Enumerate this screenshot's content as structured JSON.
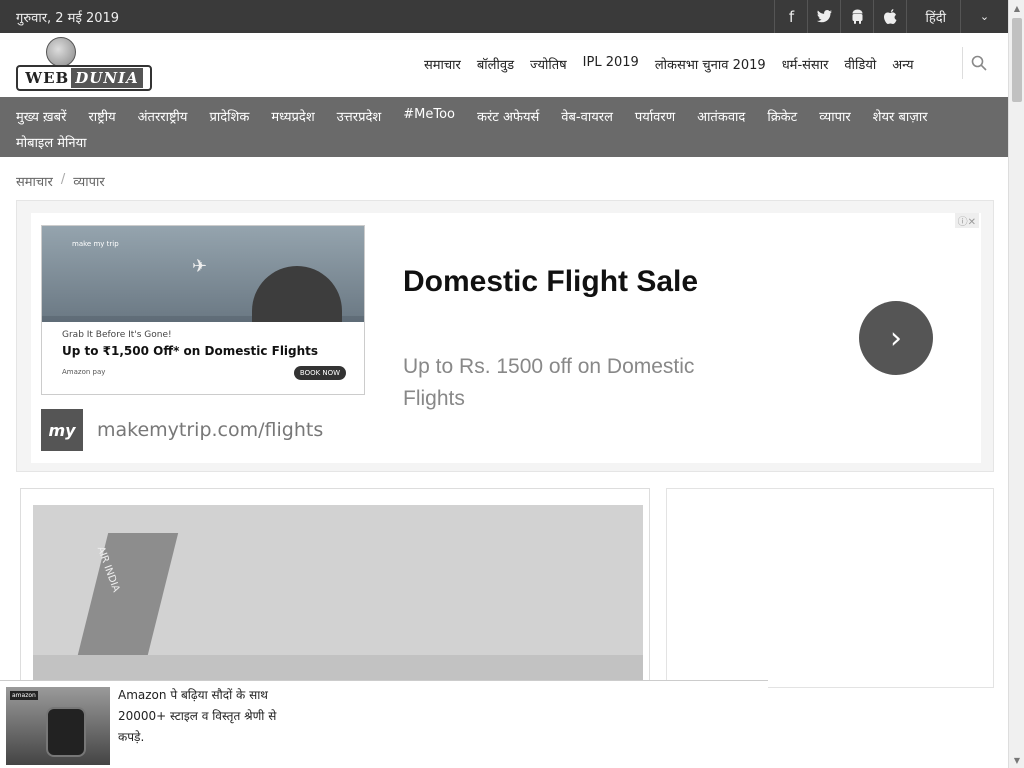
{
  "topbar": {
    "date": "गुरुवार, 2 मई 2019",
    "social_icons": [
      "facebook-icon",
      "twitter-icon",
      "android-icon",
      "apple-icon"
    ],
    "social_glyphs": [
      "f",
      "🐦",
      "🤖",
      ""
    ],
    "language": "हिंदी",
    "chevron": "⌄"
  },
  "header": {
    "logo_web": "WEB",
    "logo_dunia": "DUNIA",
    "nav": [
      "समाचार",
      "बॉलीवुड",
      "ज्योतिष",
      "IPL 2019",
      "लोकसभा चुनाव 2019",
      "धर्म-संसार",
      "वीडियो",
      "अन्य"
    ],
    "search_icon": "⌕"
  },
  "category_nav": [
    "मुख्य ख़बरें",
    "राष्ट्रीय",
    "अंतरराष्ट्रीय",
    "प्रादेशिक",
    "मध्यप्रदेश",
    "उत्तरप्रदेश",
    "#MeToo",
    "करंट अफेयर्स",
    "वेब-वायरल",
    "पर्यावरण",
    "आतंकवाद",
    "क्रिकेट",
    "व्यापार",
    "शेयर बाज़ार",
    "मोबाइल मेनिया"
  ],
  "breadcrumb": {
    "items": [
      "समाचार",
      "व्यापार"
    ],
    "separator": "/"
  },
  "ad": {
    "close_label": "ⓘ✕",
    "image_tiny": "make my trip",
    "image_line1": "Grab It Before It's Gone!",
    "image_line2": "Up to ₹1,500 Off* on Domestic Flights",
    "image_line3": "Amazon pay",
    "image_cta": "BOOK NOW",
    "brand_icon_text": "my",
    "brand_url": "makemytrip.com/flights",
    "headline": "Domestic Flight Sale",
    "subtext": "Up to Rs. 1500 off on Domestic Flights",
    "arrow": "›"
  },
  "article": {
    "tail_text": "AIR INDIA"
  },
  "sticky_ad": {
    "thumb_label": "amazon",
    "text": "Amazon पे बढ़िया सौदों के साथ 20000+ स्टाइल व विस्तृत श्रेणी से कपड़े."
  },
  "scrollbar": {
    "up": "▲",
    "down": "▼"
  }
}
